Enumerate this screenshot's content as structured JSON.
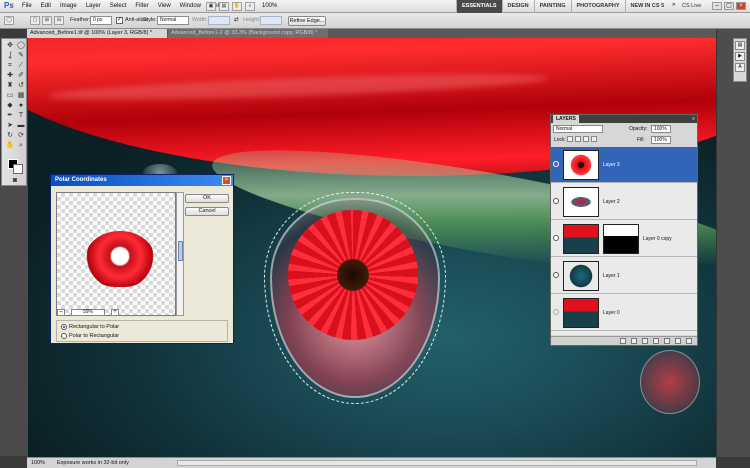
{
  "app": {
    "logo": "Ps"
  },
  "menu": [
    "File",
    "Edit",
    "Image",
    "Layer",
    "Select",
    "Filter",
    "View",
    "Window",
    "Help"
  ],
  "menubar": {
    "zoom": "100%",
    "cs_live": "CS Live"
  },
  "workspaces": [
    "ESSENTIALS",
    "DESIGN",
    "PAINTING",
    "PHOTOGRAPHY",
    "NEW IN CS 5"
  ],
  "active_workspace": "ESSENTIALS",
  "options": {
    "feather_label": "Feather:",
    "feather_value": "0 px",
    "antialias_label": "Anti-alias",
    "style_label": "Style:",
    "style_value": "Normal",
    "width_label": "Width:",
    "height_label": "Height:",
    "refine_edge": "Refine Edge..."
  },
  "doc_tabs": [
    {
      "label": "Advanced_Before1.tif @ 100% (Layer 3, RGB/8) *",
      "active": true
    },
    {
      "label": "Advanced_Before1-2 @ 33.3% (Background copy, RGB/8) *",
      "active": false
    }
  ],
  "dialog": {
    "title": "Polar Coordinates",
    "ok": "OK",
    "cancel": "Cancel",
    "zoom": "59%",
    "option1": "Rectangular to Polar",
    "option2": "Polar to Rectangular",
    "selected_option": "Rectangular to Polar"
  },
  "layers_panel": {
    "tab": "LAYERS",
    "blend_mode": "Normal",
    "opacity_label": "Opacity:",
    "opacity": "100%",
    "lock_label": "Lock:",
    "fill_label": "Fill:",
    "fill": "100%",
    "layers": [
      {
        "name": "Layer 3",
        "selected": true,
        "visible": true
      },
      {
        "name": "Layer 2",
        "selected": false,
        "visible": true
      },
      {
        "name": "Layer 0 copy",
        "selected": false,
        "visible": true,
        "has_mask": true
      },
      {
        "name": "Layer 1",
        "selected": false,
        "visible": true
      },
      {
        "name": "Layer 0",
        "selected": false,
        "visible": false
      }
    ]
  },
  "status": {
    "zoom": "100%",
    "message": "Exposure works in 32-bit only"
  },
  "colors": {
    "accent": "#3265b8",
    "petal": "#e0101c",
    "background": "#13373f"
  }
}
